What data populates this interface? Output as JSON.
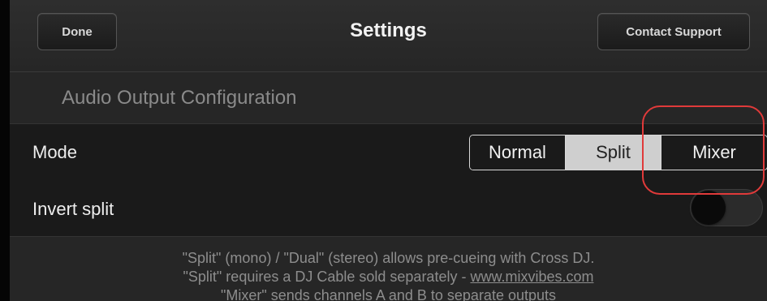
{
  "navbar": {
    "done_label": "Done",
    "title": "Settings",
    "support_label": "Contact Support"
  },
  "section": {
    "title": "Audio Output Configuration"
  },
  "mode_row": {
    "label": "Mode",
    "options": [
      "Normal",
      "Split",
      "Mixer"
    ],
    "selected": "Split"
  },
  "invert_row": {
    "label": "Invert split",
    "enabled": false
  },
  "footer": {
    "line1": "\"Split\" (mono) / \"Dual\" (stereo) allows pre-cueing with Cross DJ.",
    "line2_prefix": "\"Split\" requires a DJ Cable sold separately - ",
    "line2_link": "www.mixvibes.com",
    "line3": "\"Mixer\" sends channels A and B to separate outputs"
  },
  "colors": {
    "highlight": "#e03a3a",
    "selected_segment": "#cfcfcf"
  }
}
